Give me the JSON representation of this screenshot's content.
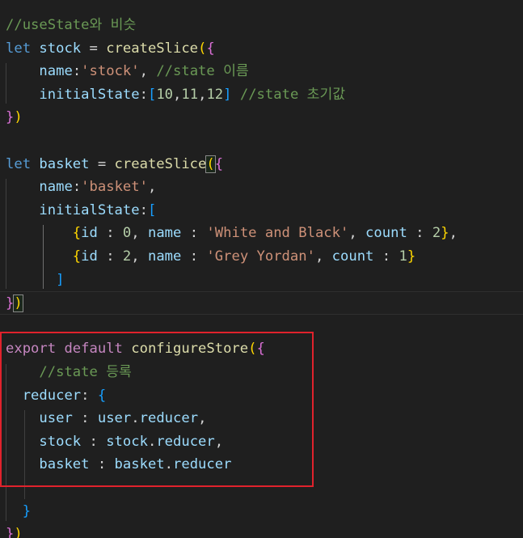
{
  "code": {
    "lines": [
      {
        "tokens": [
          {
            "t": "//useState와 비슷",
            "c": "c-comment"
          }
        ]
      },
      {
        "tokens": [
          {
            "t": "let",
            "c": "c-keyword"
          },
          {
            "t": " ",
            "c": "c-plain"
          },
          {
            "t": "stock",
            "c": "c-var"
          },
          {
            "t": " = ",
            "c": "c-plain"
          },
          {
            "t": "createSlice",
            "c": "c-func"
          },
          {
            "t": "(",
            "c": "c-b1"
          },
          {
            "t": "{",
            "c": "c-b2"
          }
        ]
      },
      {
        "tokens": [
          {
            "t": "    ",
            "c": "c-plain"
          },
          {
            "t": "name",
            "c": "c-var"
          },
          {
            "t": ":",
            "c": "c-plain"
          },
          {
            "t": "'stock'",
            "c": "c-str"
          },
          {
            "t": ", ",
            "c": "c-plain"
          },
          {
            "t": "//state 이름",
            "c": "c-comment"
          }
        ]
      },
      {
        "tokens": [
          {
            "t": "    ",
            "c": "c-plain"
          },
          {
            "t": "initialState",
            "c": "c-var"
          },
          {
            "t": ":",
            "c": "c-plain"
          },
          {
            "t": "[",
            "c": "c-b3"
          },
          {
            "t": "10",
            "c": "c-num"
          },
          {
            "t": ",",
            "c": "c-plain"
          },
          {
            "t": "11",
            "c": "c-num"
          },
          {
            "t": ",",
            "c": "c-plain"
          },
          {
            "t": "12",
            "c": "c-num"
          },
          {
            "t": "]",
            "c": "c-b3"
          },
          {
            "t": " ",
            "c": "c-plain"
          },
          {
            "t": "//state 초기값",
            "c": "c-comment"
          }
        ]
      },
      {
        "tokens": [
          {
            "t": "}",
            "c": "c-b2"
          },
          {
            "t": ")",
            "c": "c-b1"
          }
        ]
      },
      {
        "tokens": []
      },
      {
        "tokens": [
          {
            "t": "let",
            "c": "c-keyword"
          },
          {
            "t": " ",
            "c": "c-plain"
          },
          {
            "t": "basket",
            "c": "c-var"
          },
          {
            "t": " = ",
            "c": "c-plain"
          },
          {
            "t": "createSlice",
            "c": "c-func"
          },
          {
            "t": "(",
            "c": "c-b1",
            "m": true
          },
          {
            "t": "{",
            "c": "c-b2"
          }
        ]
      },
      {
        "tokens": [
          {
            "t": "    ",
            "c": "c-plain"
          },
          {
            "t": "name",
            "c": "c-var"
          },
          {
            "t": ":",
            "c": "c-plain"
          },
          {
            "t": "'basket'",
            "c": "c-str"
          },
          {
            "t": ",",
            "c": "c-plain"
          }
        ]
      },
      {
        "tokens": [
          {
            "t": "    ",
            "c": "c-plain"
          },
          {
            "t": "initialState",
            "c": "c-var"
          },
          {
            "t": ":",
            "c": "c-plain"
          },
          {
            "t": "[",
            "c": "c-b3"
          }
        ]
      },
      {
        "tokens": [
          {
            "t": "        ",
            "c": "c-plain"
          },
          {
            "t": "{",
            "c": "c-b1"
          },
          {
            "t": "id",
            "c": "c-var"
          },
          {
            "t": " : ",
            "c": "c-plain"
          },
          {
            "t": "0",
            "c": "c-num"
          },
          {
            "t": ", ",
            "c": "c-plain"
          },
          {
            "t": "name",
            "c": "c-var"
          },
          {
            "t": " : ",
            "c": "c-plain"
          },
          {
            "t": "'White and Black'",
            "c": "c-str"
          },
          {
            "t": ", ",
            "c": "c-plain"
          },
          {
            "t": "count",
            "c": "c-var"
          },
          {
            "t": " : ",
            "c": "c-plain"
          },
          {
            "t": "2",
            "c": "c-num"
          },
          {
            "t": "}",
            "c": "c-b1"
          },
          {
            "t": ",",
            "c": "c-plain"
          }
        ]
      },
      {
        "tokens": [
          {
            "t": "        ",
            "c": "c-plain"
          },
          {
            "t": "{",
            "c": "c-b1"
          },
          {
            "t": "id",
            "c": "c-var"
          },
          {
            "t": " : ",
            "c": "c-plain"
          },
          {
            "t": "2",
            "c": "c-num"
          },
          {
            "t": ", ",
            "c": "c-plain"
          },
          {
            "t": "name",
            "c": "c-var"
          },
          {
            "t": " : ",
            "c": "c-plain"
          },
          {
            "t": "'Grey Yordan'",
            "c": "c-str"
          },
          {
            "t": ", ",
            "c": "c-plain"
          },
          {
            "t": "count",
            "c": "c-var"
          },
          {
            "t": " : ",
            "c": "c-plain"
          },
          {
            "t": "1",
            "c": "c-num"
          },
          {
            "t": "}",
            "c": "c-b1"
          }
        ]
      },
      {
        "tokens": [
          {
            "t": "      ",
            "c": "c-plain"
          },
          {
            "t": "]",
            "c": "c-b3"
          }
        ]
      },
      {
        "tokens": [
          {
            "t": "}",
            "c": "c-b2"
          },
          {
            "t": ")",
            "c": "c-b1",
            "m": true
          }
        ],
        "current": true
      },
      {
        "tokens": []
      },
      {
        "tokens": [
          {
            "t": "export",
            "c": "c-control"
          },
          {
            "t": " ",
            "c": "c-plain"
          },
          {
            "t": "default",
            "c": "c-control"
          },
          {
            "t": " ",
            "c": "c-plain"
          },
          {
            "t": "configureStore",
            "c": "c-func"
          },
          {
            "t": "(",
            "c": "c-b1"
          },
          {
            "t": "{",
            "c": "c-b2"
          }
        ]
      },
      {
        "tokens": [
          {
            "t": "    ",
            "c": "c-plain"
          },
          {
            "t": "//state 등록",
            "c": "c-comment"
          }
        ]
      },
      {
        "tokens": [
          {
            "t": "  ",
            "c": "c-plain"
          },
          {
            "t": "reducer",
            "c": "c-var"
          },
          {
            "t": ": ",
            "c": "c-plain"
          },
          {
            "t": "{",
            "c": "c-b3"
          }
        ]
      },
      {
        "tokens": [
          {
            "t": "    ",
            "c": "c-plain"
          },
          {
            "t": "user",
            "c": "c-var"
          },
          {
            "t": " : ",
            "c": "c-plain"
          },
          {
            "t": "user",
            "c": "c-var"
          },
          {
            "t": ".",
            "c": "c-plain"
          },
          {
            "t": "reducer",
            "c": "c-var"
          },
          {
            "t": ",",
            "c": "c-plain"
          }
        ]
      },
      {
        "tokens": [
          {
            "t": "    ",
            "c": "c-plain"
          },
          {
            "t": "stock",
            "c": "c-var"
          },
          {
            "t": " : ",
            "c": "c-plain"
          },
          {
            "t": "stock",
            "c": "c-var"
          },
          {
            "t": ".",
            "c": "c-plain"
          },
          {
            "t": "reducer",
            "c": "c-var"
          },
          {
            "t": ",",
            "c": "c-plain"
          }
        ]
      },
      {
        "tokens": [
          {
            "t": "    ",
            "c": "c-plain"
          },
          {
            "t": "basket",
            "c": "c-var"
          },
          {
            "t": " : ",
            "c": "c-plain"
          },
          {
            "t": "basket",
            "c": "c-var"
          },
          {
            "t": ".",
            "c": "c-plain"
          },
          {
            "t": "reducer",
            "c": "c-var"
          }
        ]
      },
      {
        "tokens": []
      },
      {
        "tokens": [
          {
            "t": "  ",
            "c": "c-plain"
          },
          {
            "t": "}",
            "c": "c-b3"
          }
        ]
      },
      {
        "tokens": [
          {
            "t": "}",
            "c": "c-b2"
          },
          {
            "t": ")",
            "c": "c-b1"
          }
        ]
      }
    ]
  },
  "colors": {
    "background": "#1f1f1f",
    "highlight_box": "#e0222c"
  }
}
